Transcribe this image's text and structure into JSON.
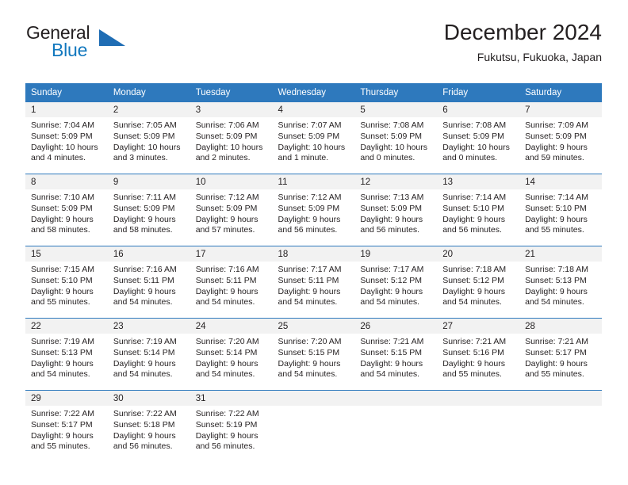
{
  "brand": {
    "name_part1": "General",
    "name_part2": "Blue",
    "triangle_icon": "triangle-icon",
    "colors": {
      "text": "#231f20",
      "blue": "#1278be",
      "triangle": "#1f6db4"
    }
  },
  "header": {
    "title": "December 2024",
    "subtitle": "Fukutsu, Fukuoka, Japan"
  },
  "calendar": {
    "accent_color": "#2e79bd",
    "daynum_background": "#f2f2f2",
    "weekdays": [
      "Sunday",
      "Monday",
      "Tuesday",
      "Wednesday",
      "Thursday",
      "Friday",
      "Saturday"
    ],
    "weeks": [
      [
        {
          "day": "1",
          "sunrise": "Sunrise: 7:04 AM",
          "sunset": "Sunset: 5:09 PM",
          "daylight_line1": "Daylight: 10 hours",
          "daylight_line2": "and 4 minutes."
        },
        {
          "day": "2",
          "sunrise": "Sunrise: 7:05 AM",
          "sunset": "Sunset: 5:09 PM",
          "daylight_line1": "Daylight: 10 hours",
          "daylight_line2": "and 3 minutes."
        },
        {
          "day": "3",
          "sunrise": "Sunrise: 7:06 AM",
          "sunset": "Sunset: 5:09 PM",
          "daylight_line1": "Daylight: 10 hours",
          "daylight_line2": "and 2 minutes."
        },
        {
          "day": "4",
          "sunrise": "Sunrise: 7:07 AM",
          "sunset": "Sunset: 5:09 PM",
          "daylight_line1": "Daylight: 10 hours",
          "daylight_line2": "and 1 minute."
        },
        {
          "day": "5",
          "sunrise": "Sunrise: 7:08 AM",
          "sunset": "Sunset: 5:09 PM",
          "daylight_line1": "Daylight: 10 hours",
          "daylight_line2": "and 0 minutes."
        },
        {
          "day": "6",
          "sunrise": "Sunrise: 7:08 AM",
          "sunset": "Sunset: 5:09 PM",
          "daylight_line1": "Daylight: 10 hours",
          "daylight_line2": "and 0 minutes."
        },
        {
          "day": "7",
          "sunrise": "Sunrise: 7:09 AM",
          "sunset": "Sunset: 5:09 PM",
          "daylight_line1": "Daylight: 9 hours",
          "daylight_line2": "and 59 minutes."
        }
      ],
      [
        {
          "day": "8",
          "sunrise": "Sunrise: 7:10 AM",
          "sunset": "Sunset: 5:09 PM",
          "daylight_line1": "Daylight: 9 hours",
          "daylight_line2": "and 58 minutes."
        },
        {
          "day": "9",
          "sunrise": "Sunrise: 7:11 AM",
          "sunset": "Sunset: 5:09 PM",
          "daylight_line1": "Daylight: 9 hours",
          "daylight_line2": "and 58 minutes."
        },
        {
          "day": "10",
          "sunrise": "Sunrise: 7:12 AM",
          "sunset": "Sunset: 5:09 PM",
          "daylight_line1": "Daylight: 9 hours",
          "daylight_line2": "and 57 minutes."
        },
        {
          "day": "11",
          "sunrise": "Sunrise: 7:12 AM",
          "sunset": "Sunset: 5:09 PM",
          "daylight_line1": "Daylight: 9 hours",
          "daylight_line2": "and 56 minutes."
        },
        {
          "day": "12",
          "sunrise": "Sunrise: 7:13 AM",
          "sunset": "Sunset: 5:09 PM",
          "daylight_line1": "Daylight: 9 hours",
          "daylight_line2": "and 56 minutes."
        },
        {
          "day": "13",
          "sunrise": "Sunrise: 7:14 AM",
          "sunset": "Sunset: 5:10 PM",
          "daylight_line1": "Daylight: 9 hours",
          "daylight_line2": "and 56 minutes."
        },
        {
          "day": "14",
          "sunrise": "Sunrise: 7:14 AM",
          "sunset": "Sunset: 5:10 PM",
          "daylight_line1": "Daylight: 9 hours",
          "daylight_line2": "and 55 minutes."
        }
      ],
      [
        {
          "day": "15",
          "sunrise": "Sunrise: 7:15 AM",
          "sunset": "Sunset: 5:10 PM",
          "daylight_line1": "Daylight: 9 hours",
          "daylight_line2": "and 55 minutes."
        },
        {
          "day": "16",
          "sunrise": "Sunrise: 7:16 AM",
          "sunset": "Sunset: 5:11 PM",
          "daylight_line1": "Daylight: 9 hours",
          "daylight_line2": "and 54 minutes."
        },
        {
          "day": "17",
          "sunrise": "Sunrise: 7:16 AM",
          "sunset": "Sunset: 5:11 PM",
          "daylight_line1": "Daylight: 9 hours",
          "daylight_line2": "and 54 minutes."
        },
        {
          "day": "18",
          "sunrise": "Sunrise: 7:17 AM",
          "sunset": "Sunset: 5:11 PM",
          "daylight_line1": "Daylight: 9 hours",
          "daylight_line2": "and 54 minutes."
        },
        {
          "day": "19",
          "sunrise": "Sunrise: 7:17 AM",
          "sunset": "Sunset: 5:12 PM",
          "daylight_line1": "Daylight: 9 hours",
          "daylight_line2": "and 54 minutes."
        },
        {
          "day": "20",
          "sunrise": "Sunrise: 7:18 AM",
          "sunset": "Sunset: 5:12 PM",
          "daylight_line1": "Daylight: 9 hours",
          "daylight_line2": "and 54 minutes."
        },
        {
          "day": "21",
          "sunrise": "Sunrise: 7:18 AM",
          "sunset": "Sunset: 5:13 PM",
          "daylight_line1": "Daylight: 9 hours",
          "daylight_line2": "and 54 minutes."
        }
      ],
      [
        {
          "day": "22",
          "sunrise": "Sunrise: 7:19 AM",
          "sunset": "Sunset: 5:13 PM",
          "daylight_line1": "Daylight: 9 hours",
          "daylight_line2": "and 54 minutes."
        },
        {
          "day": "23",
          "sunrise": "Sunrise: 7:19 AM",
          "sunset": "Sunset: 5:14 PM",
          "daylight_line1": "Daylight: 9 hours",
          "daylight_line2": "and 54 minutes."
        },
        {
          "day": "24",
          "sunrise": "Sunrise: 7:20 AM",
          "sunset": "Sunset: 5:14 PM",
          "daylight_line1": "Daylight: 9 hours",
          "daylight_line2": "and 54 minutes."
        },
        {
          "day": "25",
          "sunrise": "Sunrise: 7:20 AM",
          "sunset": "Sunset: 5:15 PM",
          "daylight_line1": "Daylight: 9 hours",
          "daylight_line2": "and 54 minutes."
        },
        {
          "day": "26",
          "sunrise": "Sunrise: 7:21 AM",
          "sunset": "Sunset: 5:15 PM",
          "daylight_line1": "Daylight: 9 hours",
          "daylight_line2": "and 54 minutes."
        },
        {
          "day": "27",
          "sunrise": "Sunrise: 7:21 AM",
          "sunset": "Sunset: 5:16 PM",
          "daylight_line1": "Daylight: 9 hours",
          "daylight_line2": "and 55 minutes."
        },
        {
          "day": "28",
          "sunrise": "Sunrise: 7:21 AM",
          "sunset": "Sunset: 5:17 PM",
          "daylight_line1": "Daylight: 9 hours",
          "daylight_line2": "and 55 minutes."
        }
      ],
      [
        {
          "day": "29",
          "sunrise": "Sunrise: 7:22 AM",
          "sunset": "Sunset: 5:17 PM",
          "daylight_line1": "Daylight: 9 hours",
          "daylight_line2": "and 55 minutes."
        },
        {
          "day": "30",
          "sunrise": "Sunrise: 7:22 AM",
          "sunset": "Sunset: 5:18 PM",
          "daylight_line1": "Daylight: 9 hours",
          "daylight_line2": "and 56 minutes."
        },
        {
          "day": "31",
          "sunrise": "Sunrise: 7:22 AM",
          "sunset": "Sunset: 5:19 PM",
          "daylight_line1": "Daylight: 9 hours",
          "daylight_line2": "and 56 minutes."
        },
        {
          "day": "",
          "sunrise": "",
          "sunset": "",
          "daylight_line1": "",
          "daylight_line2": ""
        },
        {
          "day": "",
          "sunrise": "",
          "sunset": "",
          "daylight_line1": "",
          "daylight_line2": ""
        },
        {
          "day": "",
          "sunrise": "",
          "sunset": "",
          "daylight_line1": "",
          "daylight_line2": ""
        },
        {
          "day": "",
          "sunrise": "",
          "sunset": "",
          "daylight_line1": "",
          "daylight_line2": ""
        }
      ]
    ]
  }
}
